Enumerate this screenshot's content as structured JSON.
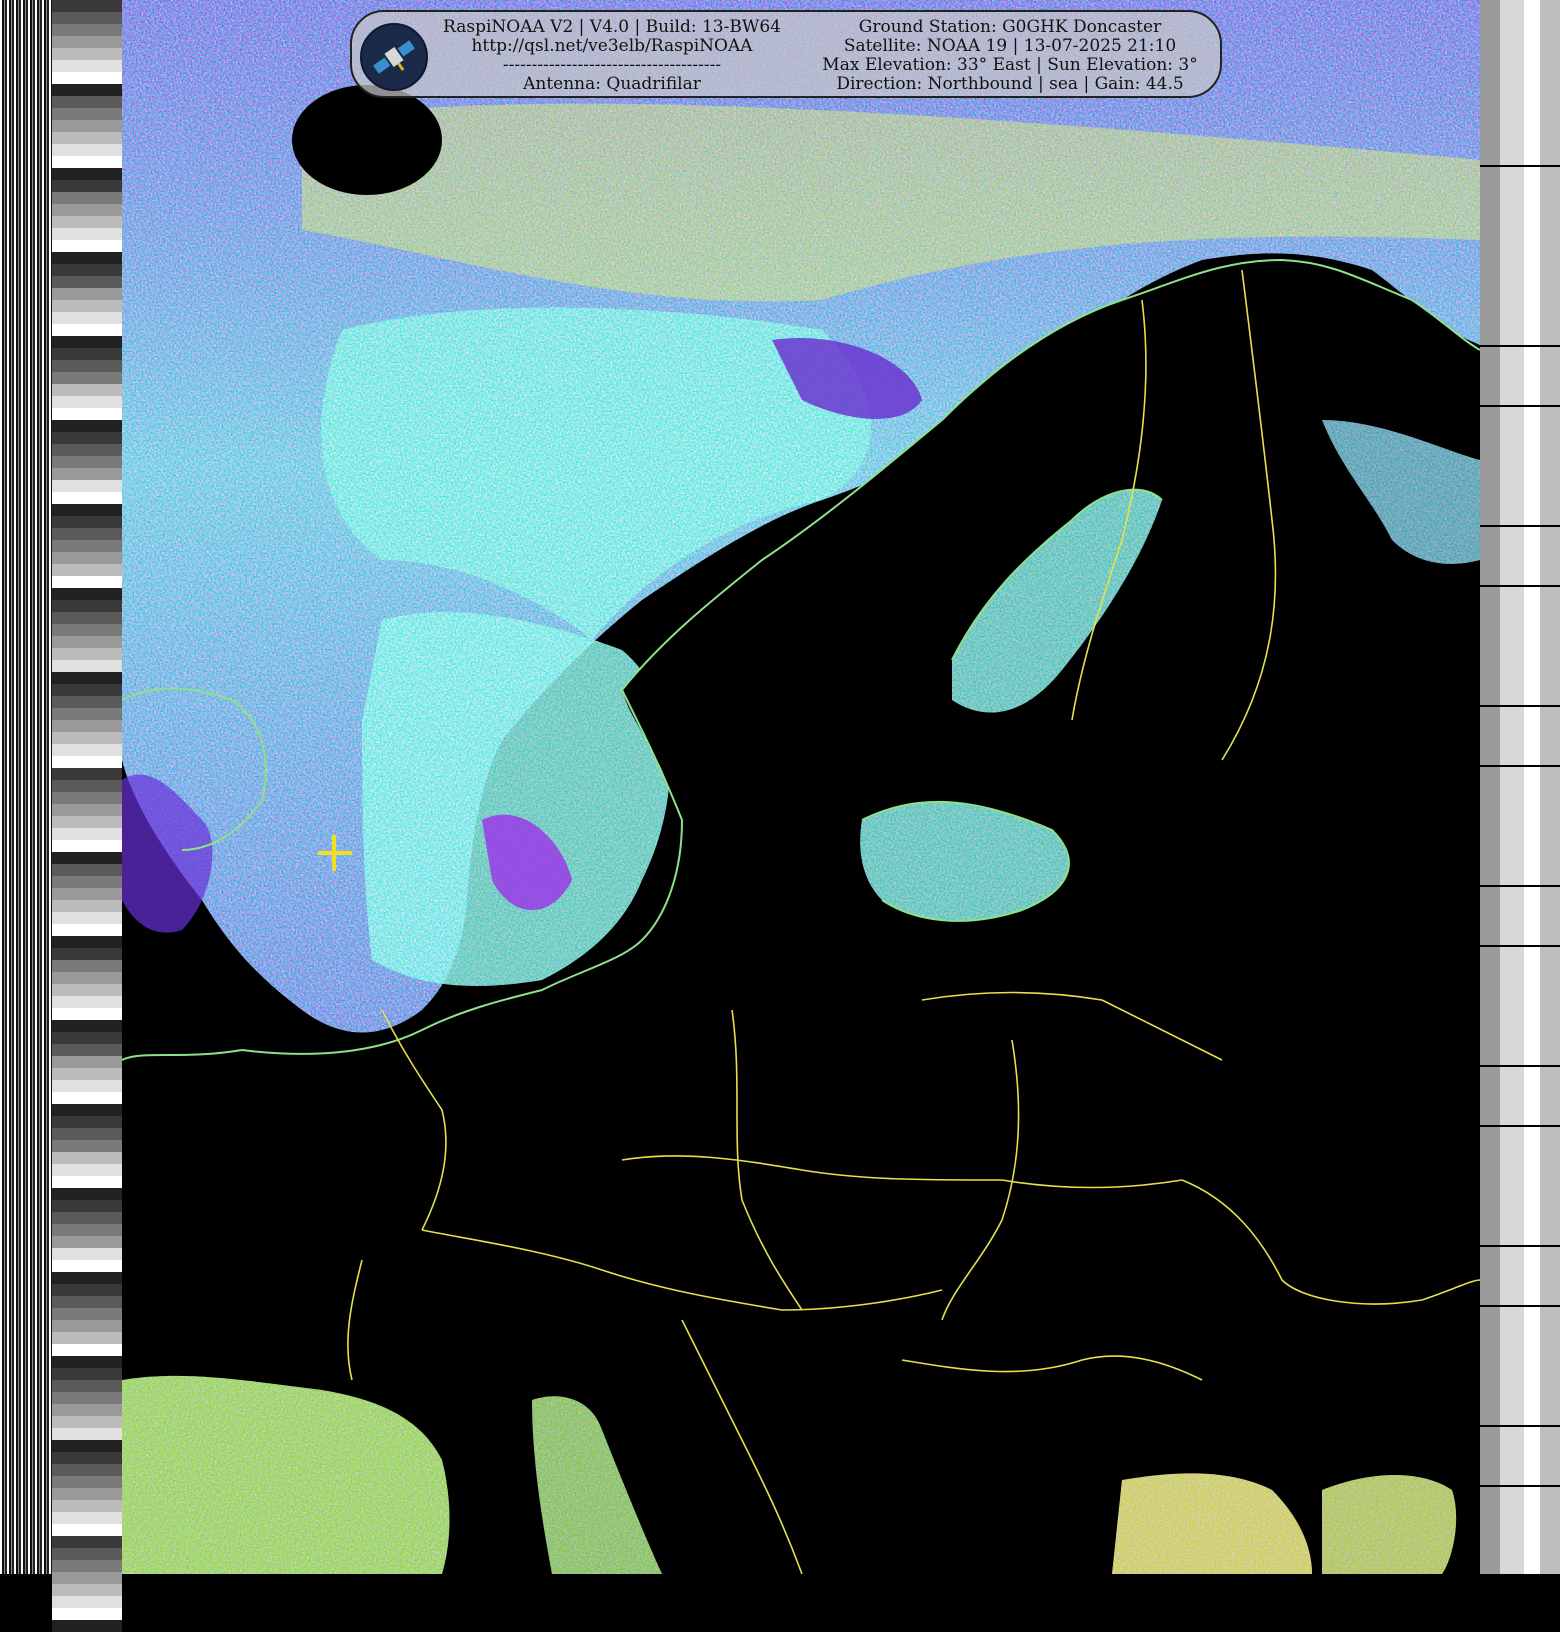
{
  "header": {
    "left_lines": [
      "RaspiNOAA V2 | V4.0 | Build: 13-BW64",
      "http://qsl.net/ve3elb/RaspiNOAA",
      "--------------------------------------",
      "Antenna: Quadrifilar"
    ],
    "right_lines": [
      "Ground Station: G0GHK Doncaster",
      "Satellite: NOAA 19 | 13-07-2025 21:10",
      "Max Elevation: 33° East | Sun Elevation: 3°",
      "Direction: Northbound | sea | Gain: 44.5"
    ]
  },
  "logo_icon": "satellite-icon",
  "colors": {
    "land": "#000000",
    "coastline": "#8fe08a",
    "borders": "#e8e04a",
    "cloud_cyan": "#3fe8e0",
    "cloud_purple": "#8a3ae6",
    "cloud_blue": "#3a5ae8",
    "cloud_green": "#8ee84a",
    "station_marker": "#f0e020"
  }
}
